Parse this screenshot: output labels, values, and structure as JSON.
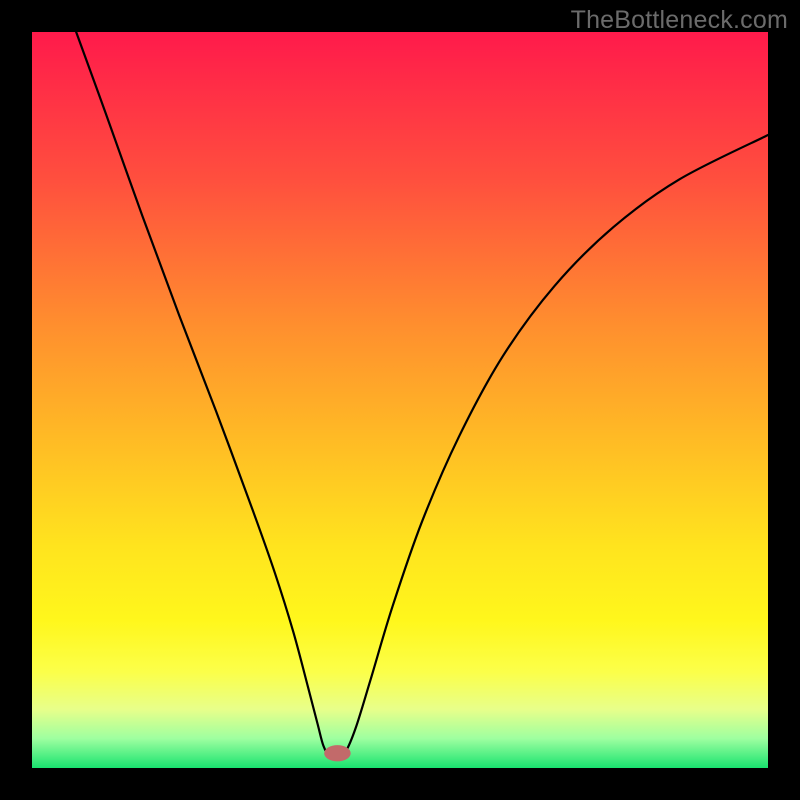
{
  "watermark": "TheBottleneck.com",
  "chart_data": {
    "type": "line",
    "title": "",
    "xlabel": "",
    "ylabel": "",
    "xlim": [
      0,
      100
    ],
    "ylim": [
      0,
      100
    ],
    "axes_visible": false,
    "background_gradient": {
      "stops": [
        {
          "offset": 0.0,
          "color": "#ff1a4b"
        },
        {
          "offset": 0.2,
          "color": "#ff4f3e"
        },
        {
          "offset": 0.4,
          "color": "#ff8f2e"
        },
        {
          "offset": 0.55,
          "color": "#ffba25"
        },
        {
          "offset": 0.7,
          "color": "#ffe41e"
        },
        {
          "offset": 0.8,
          "color": "#fff71c"
        },
        {
          "offset": 0.87,
          "color": "#fbff4a"
        },
        {
          "offset": 0.92,
          "color": "#e8ff8a"
        },
        {
          "offset": 0.96,
          "color": "#9effa0"
        },
        {
          "offset": 1.0,
          "color": "#19e36f"
        }
      ]
    },
    "vertex": {
      "x": 40.5,
      "y": 1.5
    },
    "marker": {
      "x": 41.5,
      "y": 2.0,
      "color": "#c26a6a",
      "rx": 1.8,
      "ry": 1.1
    },
    "series": [
      {
        "name": "curve",
        "color": "#000000",
        "width": 2.2,
        "points": [
          {
            "x": 6.0,
            "y": 100.0
          },
          {
            "x": 10.0,
            "y": 89.0
          },
          {
            "x": 15.0,
            "y": 75.0
          },
          {
            "x": 20.0,
            "y": 61.5
          },
          {
            "x": 25.0,
            "y": 48.5
          },
          {
            "x": 30.0,
            "y": 35.0
          },
          {
            "x": 33.0,
            "y": 26.5
          },
          {
            "x": 35.5,
            "y": 18.5
          },
          {
            "x": 37.5,
            "y": 11.0
          },
          {
            "x": 38.8,
            "y": 6.0
          },
          {
            "x": 39.6,
            "y": 3.0
          },
          {
            "x": 40.5,
            "y": 1.5
          },
          {
            "x": 41.5,
            "y": 1.5
          },
          {
            "x": 42.6,
            "y": 2.2
          },
          {
            "x": 44.0,
            "y": 5.5
          },
          {
            "x": 46.0,
            "y": 12.0
          },
          {
            "x": 49.0,
            "y": 22.0
          },
          {
            "x": 53.0,
            "y": 33.5
          },
          {
            "x": 58.0,
            "y": 45.0
          },
          {
            "x": 64.0,
            "y": 56.0
          },
          {
            "x": 71.0,
            "y": 65.5
          },
          {
            "x": 79.0,
            "y": 73.5
          },
          {
            "x": 88.0,
            "y": 80.0
          },
          {
            "x": 100.0,
            "y": 86.0
          }
        ]
      }
    ]
  }
}
